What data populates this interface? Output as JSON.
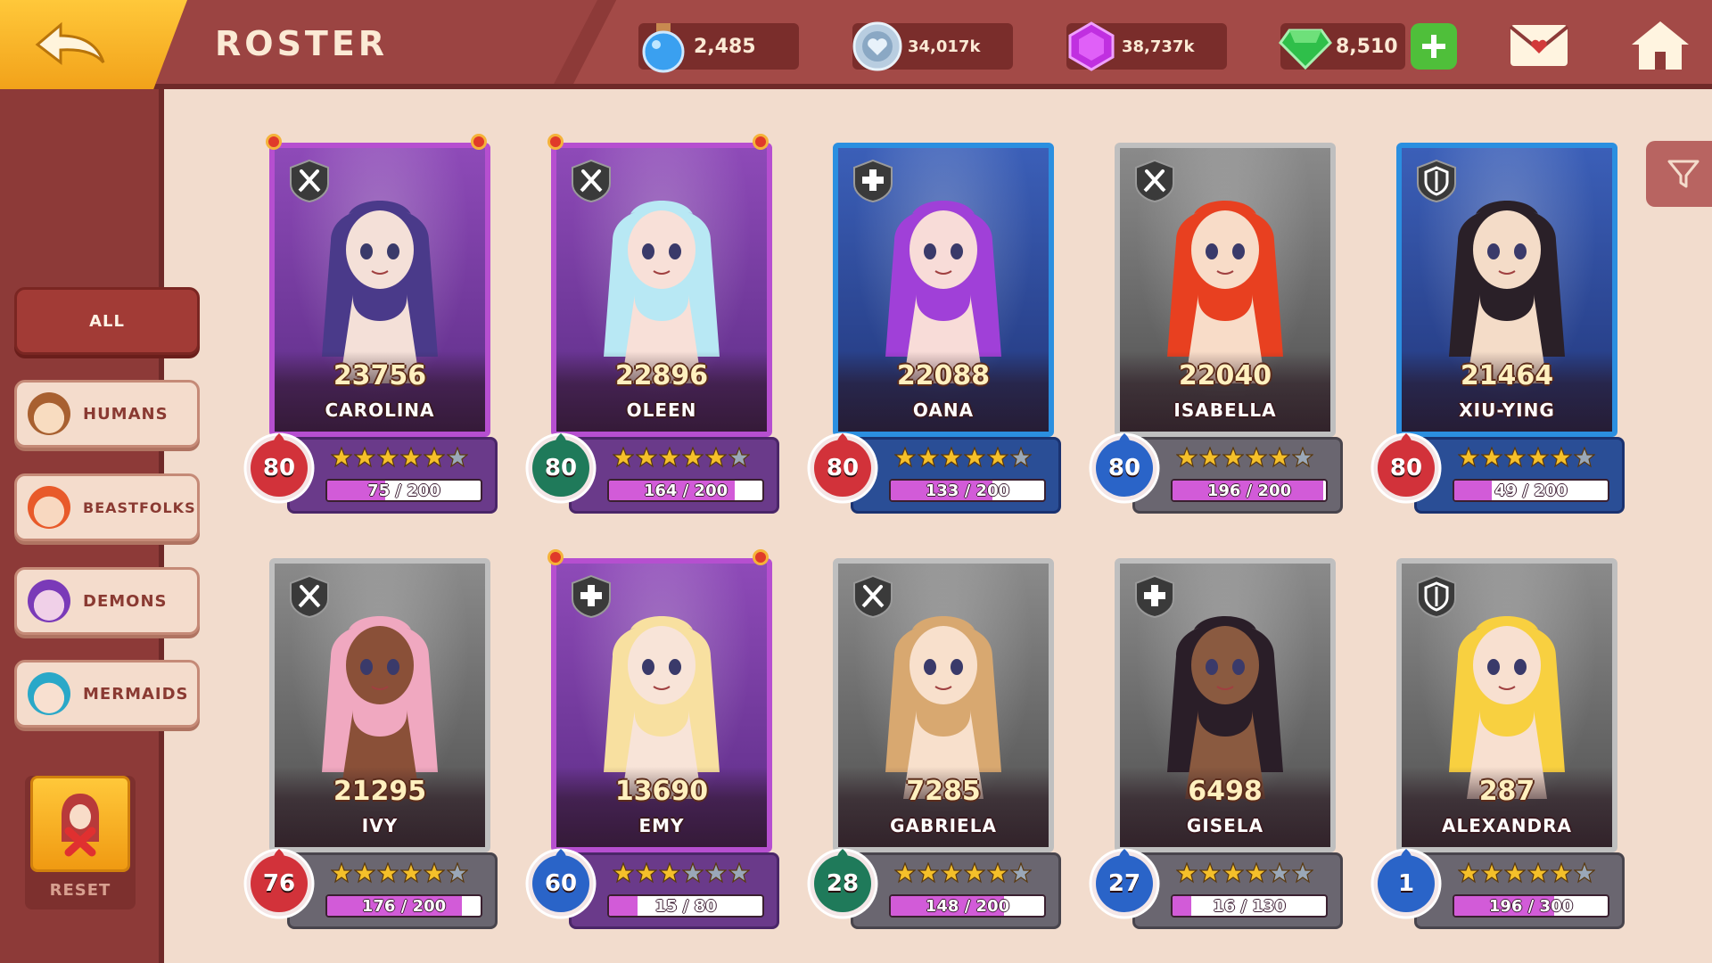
{
  "header": {
    "title": "ROSTER",
    "resources": [
      {
        "name": "potion",
        "value": "2,485"
      },
      {
        "name": "silver-heart-coin",
        "value": "34,017k"
      },
      {
        "name": "purple-gem",
        "value": "38,737k"
      },
      {
        "name": "green-emerald",
        "value": "8,510"
      }
    ]
  },
  "sidebar": {
    "filters": [
      {
        "label": "ALL",
        "active": true
      },
      {
        "label": "HUMANS"
      },
      {
        "label": "BEASTFOLKS"
      },
      {
        "label": "DEMONS"
      },
      {
        "label": "MERMAIDS"
      }
    ],
    "reset_label": "RESET"
  },
  "heroes": [
    {
      "power": "23756",
      "name": "CAROLINA",
      "level": "80",
      "xp": "75 / 200",
      "xp_fraction": 0.375,
      "stars": 5,
      "max_stars": 6,
      "frame": "purple",
      "orb": "red",
      "class": "swords",
      "hair": "#4a3a8a",
      "skin": "#f4e0d8"
    },
    {
      "power": "22896",
      "name": "OLEEN",
      "level": "80",
      "xp": "164 / 200",
      "xp_fraction": 0.82,
      "stars": 5,
      "max_stars": 6,
      "frame": "purple",
      "orb": "green",
      "class": "swords",
      "hair": "#b8e8f4",
      "skin": "#f8e0d8"
    },
    {
      "power": "22088",
      "name": "OANA",
      "level": "80",
      "xp": "133 / 200",
      "xp_fraction": 0.665,
      "stars": 5,
      "max_stars": 6,
      "frame": "blue",
      "orb": "red",
      "class": "plus",
      "hair": "#a040d8",
      "skin": "#f8dcd8"
    },
    {
      "power": "22040",
      "name": "ISABELLA",
      "level": "80",
      "xp": "196 / 200",
      "xp_fraction": 0.98,
      "stars": 5,
      "max_stars": 6,
      "frame": "gray",
      "orb": "blue",
      "class": "swords",
      "hair": "#e84020",
      "skin": "#f8dcc8"
    },
    {
      "power": "21464",
      "name": "XIU-YING",
      "level": "80",
      "xp": "49 / 200",
      "xp_fraction": 0.245,
      "stars": 5,
      "max_stars": 6,
      "frame": "blue",
      "orb": "red",
      "class": "shield",
      "hair": "#2a2028",
      "skin": "#f4dcc8"
    },
    {
      "power": "21295",
      "name": "IVY",
      "level": "76",
      "xp": "176 / 200",
      "xp_fraction": 0.88,
      "stars": 5,
      "max_stars": 6,
      "frame": "gray",
      "orb": "red",
      "class": "swords",
      "hair": "#f0a8c0",
      "skin": "#8a5038"
    },
    {
      "power": "13690",
      "name": "EMY",
      "level": "60",
      "xp": "15 / 80",
      "xp_fraction": 0.1875,
      "stars": 3,
      "max_stars": 6,
      "frame": "purple",
      "orb": "blue",
      "class": "plus",
      "hair": "#f8e0a0",
      "skin": "#f8e4d8"
    },
    {
      "power": "7285",
      "name": "GABRIELA",
      "level": "28",
      "xp": "148 / 200",
      "xp_fraction": 0.74,
      "stars": 5,
      "max_stars": 6,
      "frame": "gray",
      "orb": "green",
      "class": "swords",
      "hair": "#d8a870",
      "skin": "#f8e0cc"
    },
    {
      "power": "6498",
      "name": "GISELA",
      "level": "27",
      "xp": "16 / 130",
      "xp_fraction": 0.123,
      "stars": 4,
      "max_stars": 6,
      "frame": "gray",
      "orb": "blue",
      "class": "plus",
      "hair": "#2a1e28",
      "skin": "#8a5a40"
    },
    {
      "power": "287",
      "name": "ALEXANDRA",
      "level": "1",
      "xp": "196 / 300",
      "xp_fraction": 0.653,
      "stars": 5,
      "max_stars": 6,
      "frame": "gray",
      "orb": "blue",
      "class": "shield",
      "hair": "#f8d040",
      "skin": "#f8e0d0"
    }
  ],
  "colors": {
    "orb_red": "#d2323a",
    "orb_green": "#1f7a5a",
    "orb_blue": "#2a64c8",
    "star_gold": "#f5c02a",
    "star_empty": "#9aa8b8"
  }
}
